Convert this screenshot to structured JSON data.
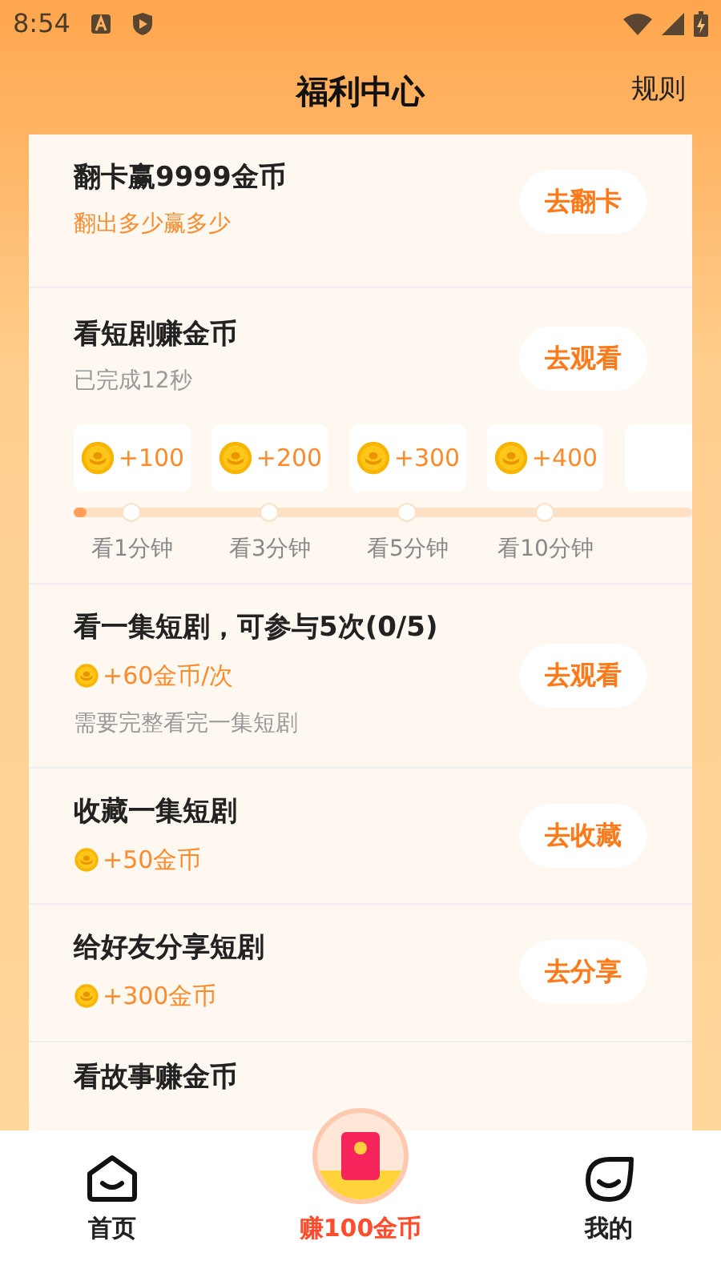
{
  "status_bar": {
    "time": "8:54"
  },
  "header": {
    "title": "福利中心",
    "rules_link": "规则"
  },
  "tasks": [
    {
      "kind": "plain",
      "title": "翻卡赢9999金币",
      "subtitle": "翻出多少赢多少",
      "subtitle_highlight": true,
      "button": "去翻卡"
    },
    {
      "kind": "milestones",
      "title": "看短剧赚金币",
      "subtitle": "已完成12秒",
      "subtitle_highlight": false,
      "button": "去观看",
      "level": 0.01,
      "milestones": [
        {
          "reward": "+100",
          "label": "看1分钟"
        },
        {
          "reward": "+200",
          "label": "看3分钟"
        },
        {
          "reward": "+300",
          "label": "看5分钟"
        },
        {
          "reward": "+400",
          "label": "看10分钟"
        }
      ]
    },
    {
      "kind": "reward",
      "title": "看一集短剧，可参与5次(0/5)",
      "reward": "+60金币/次",
      "note": "需要完整看完一集短剧",
      "button": "去观看"
    },
    {
      "kind": "reward",
      "title": "收藏一集短剧",
      "reward": "+50金币",
      "button": "去收藏"
    },
    {
      "kind": "reward",
      "title": "给好友分享短剧",
      "reward": "+300金币",
      "button": "去分享"
    },
    {
      "kind": "cut",
      "title": "看故事赚金币"
    }
  ],
  "nav": [
    {
      "kind": "home",
      "label": "首页",
      "selected": false
    },
    {
      "kind": "earn",
      "label": "赚100金币",
      "selected": true
    },
    {
      "kind": "me",
      "label": "我的",
      "selected": false
    }
  ]
}
